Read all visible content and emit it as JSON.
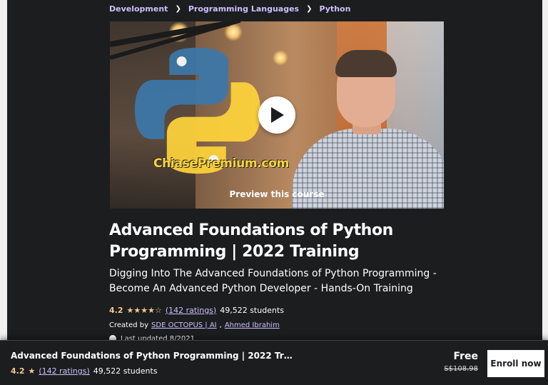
{
  "breadcrumb": {
    "items": [
      {
        "label": "Development"
      },
      {
        "label": "Programming Languages"
      },
      {
        "label": "Python"
      }
    ]
  },
  "preview": {
    "watermark": "ChiasePremium.com",
    "label": "Preview this course",
    "icons": {
      "play": "play-icon",
      "logo": "python-logo"
    }
  },
  "course": {
    "title": "Advanced Foundations of Python Programming | 2022 Training",
    "subtitle": "Digging Into The Advanced Foundations of Python Programming - Become An Advanced Python Developer - Hands-On Training",
    "rating": "4.2",
    "stars": "★★★★☆",
    "rating_fraction": 0.84,
    "ratings_count": "(142 ratings)",
    "students": "49,522 students",
    "created_by_label": "Created by",
    "instructors": [
      "SDE OCTOPUS | AI",
      "Ahmed Ibrahim"
    ],
    "instructor_separator": ",",
    "last_updated": "Last updated 8/2021"
  },
  "sticky": {
    "title": "Advanced Foundations of Python Programming | 2022 Train...",
    "rating": "4.2",
    "star": "★",
    "ratings_count": "(142 ratings)",
    "students": "49,522 students",
    "price": "Free",
    "original_price": "S$108.98",
    "enroll_label": "Enroll now"
  },
  "colors": {
    "background": "#1c1d1f",
    "link": "#cec0fc",
    "star": "#f3ca8c",
    "watermark": "#ffd43b",
    "button_bg": "#ffffff",
    "button_text": "#1c1d1f"
  }
}
